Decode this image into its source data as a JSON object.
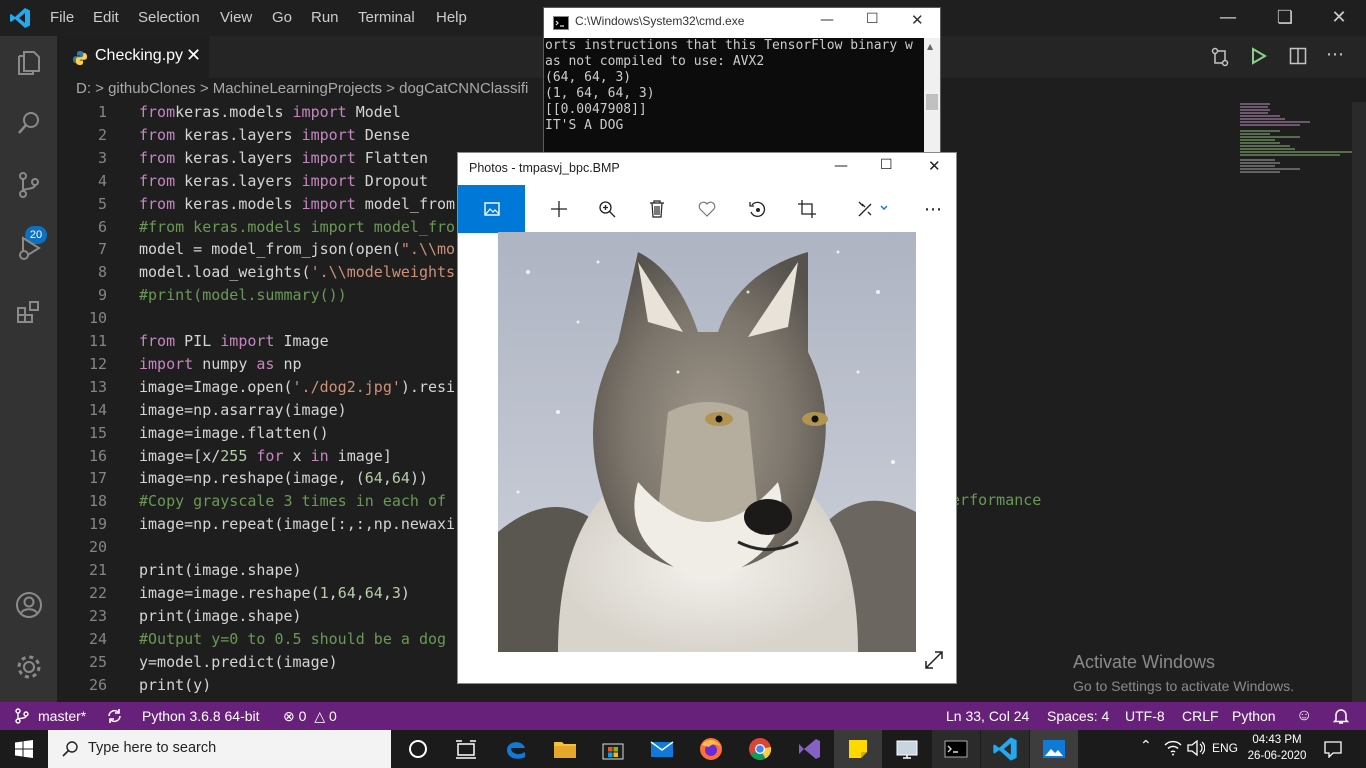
{
  "menu": [
    "File",
    "Edit",
    "Selection",
    "View",
    "Go",
    "Run",
    "Terminal",
    "Help"
  ],
  "editor": {
    "tab_title": "Checking.py",
    "tab_close": "✕",
    "breadcrumb": "D: > githubClones > MachineLearningProjects > dogCatCNNClassifi",
    "scm_badge": "20",
    "overflow_text": "performance"
  },
  "lines": [
    {
      "n": "1",
      "segs": [
        [
          "kw",
          "from"
        ],
        [
          "",
          "keras.models "
        ],
        [
          "kw",
          "import"
        ],
        [
          "",
          " Model"
        ]
      ]
    },
    {
      "n": "2",
      "segs": [
        [
          "kw",
          "from"
        ],
        [
          "",
          " keras.layers "
        ],
        [
          "kw",
          "import"
        ],
        [
          "",
          " Dense"
        ]
      ]
    },
    {
      "n": "3",
      "segs": [
        [
          "kw",
          "from"
        ],
        [
          "",
          " keras.layers "
        ],
        [
          "kw",
          "import"
        ],
        [
          "",
          " Flatten"
        ]
      ]
    },
    {
      "n": "4",
      "segs": [
        [
          "kw",
          "from"
        ],
        [
          "",
          " keras.layers "
        ],
        [
          "kw",
          "import"
        ],
        [
          "",
          " Dropout"
        ]
      ]
    },
    {
      "n": "5",
      "segs": [
        [
          "kw",
          "from"
        ],
        [
          "",
          " keras.models "
        ],
        [
          "kw",
          "import"
        ],
        [
          "",
          " model_from"
        ]
      ]
    },
    {
      "n": "6",
      "segs": [
        [
          "cm",
          "#from keras.models import model_fro"
        ]
      ]
    },
    {
      "n": "7",
      "segs": [
        [
          "",
          "model = model_from_json(open("
        ],
        [
          "st",
          "\".\\\\mo"
        ]
      ]
    },
    {
      "n": "8",
      "segs": [
        [
          "",
          "model.load_weights("
        ],
        [
          "st",
          "'.\\\\modelweights"
        ]
      ]
    },
    {
      "n": "9",
      "segs": [
        [
          "cm",
          "#print(model.summary())"
        ]
      ]
    },
    {
      "n": "10",
      "segs": []
    },
    {
      "n": "11",
      "segs": [
        [
          "kw",
          "from"
        ],
        [
          "",
          " PIL "
        ],
        [
          "kw",
          "import"
        ],
        [
          "",
          " Image"
        ]
      ]
    },
    {
      "n": "12",
      "segs": [
        [
          "kw",
          "import"
        ],
        [
          "",
          " numpy "
        ],
        [
          "kw",
          "as"
        ],
        [
          "",
          " np"
        ]
      ]
    },
    {
      "n": "13",
      "segs": [
        [
          "",
          "image=Image.open("
        ],
        [
          "st",
          "'./dog2.jpg'"
        ],
        [
          "",
          ").resi"
        ]
      ]
    },
    {
      "n": "14",
      "segs": [
        [
          "",
          "image=np.asarray(image)"
        ]
      ]
    },
    {
      "n": "15",
      "segs": [
        [
          "",
          "image=image.flatten()"
        ]
      ]
    },
    {
      "n": "16",
      "segs": [
        [
          "",
          "image=[x/"
        ],
        [
          "nm",
          "255"
        ],
        [
          "",
          " "
        ],
        [
          "kw",
          "for"
        ],
        [
          "",
          " x "
        ],
        [
          "kw",
          "in"
        ],
        [
          "",
          " image]"
        ]
      ]
    },
    {
      "n": "17",
      "segs": [
        [
          "",
          "image=np.reshape(image, ("
        ],
        [
          "nm",
          "64"
        ],
        [
          "",
          ","
        ],
        [
          "nm",
          "64"
        ],
        [
          "",
          "))"
        ]
      ]
    },
    {
      "n": "18",
      "segs": [
        [
          "cm",
          "#Copy grayscale 3 times in each of"
        ]
      ]
    },
    {
      "n": "19",
      "segs": [
        [
          "",
          "image=np.repeat(image[:,:,np.newaxi"
        ]
      ]
    },
    {
      "n": "20",
      "segs": []
    },
    {
      "n": "21",
      "segs": [
        [
          "",
          "print(image.shape)"
        ]
      ]
    },
    {
      "n": "22",
      "segs": [
        [
          "",
          "image=image.reshape("
        ],
        [
          "nm",
          "1"
        ],
        [
          "",
          ","
        ],
        [
          "nm",
          "64"
        ],
        [
          "",
          ","
        ],
        [
          "nm",
          "64"
        ],
        [
          "",
          ","
        ],
        [
          "nm",
          "3"
        ],
        [
          "",
          ")"
        ]
      ]
    },
    {
      "n": "23",
      "segs": [
        [
          "",
          "print(image.shape)"
        ]
      ]
    },
    {
      "n": "24",
      "segs": [
        [
          "cm",
          "#Output y=0 to 0.5 should be a dog"
        ]
      ]
    },
    {
      "n": "25",
      "segs": [
        [
          "",
          "y=model.predict(image)"
        ]
      ]
    },
    {
      "n": "26",
      "segs": [
        [
          "",
          "print(y)"
        ]
      ]
    }
  ],
  "status": {
    "branch": "master*",
    "interpreter": "Python 3.6.8 64-bit",
    "errors": "0",
    "warnings": "0",
    "position": "Ln 33, Col 24",
    "spaces": "Spaces: 4",
    "encoding": "UTF-8",
    "eol": "CRLF",
    "language": "Python"
  },
  "cmd": {
    "title": "C:\\Windows\\System32\\cmd.exe",
    "lines": [
      "orts instructions that this TensorFlow binary w",
      "as not compiled to use: AVX2",
      "(64, 64, 3)",
      "(1, 64, 64, 3)",
      "[[0.0047908]]",
      "IT'S A DOG"
    ]
  },
  "photos": {
    "title": "Photos - tmpasvj_bpc.BMP",
    "image": "wolf-photo"
  },
  "activate": {
    "title": "Activate Windows",
    "subtitle": "Go to Settings to activate Windows."
  },
  "taskbar": {
    "search_placeholder": "Type here to search",
    "lang": "ENG",
    "time": "04:43 PM",
    "date": "26-06-2020"
  },
  "colors": {
    "statusbar": "#68217a",
    "accent": "#0078d7",
    "badge": "#0e70c0"
  }
}
